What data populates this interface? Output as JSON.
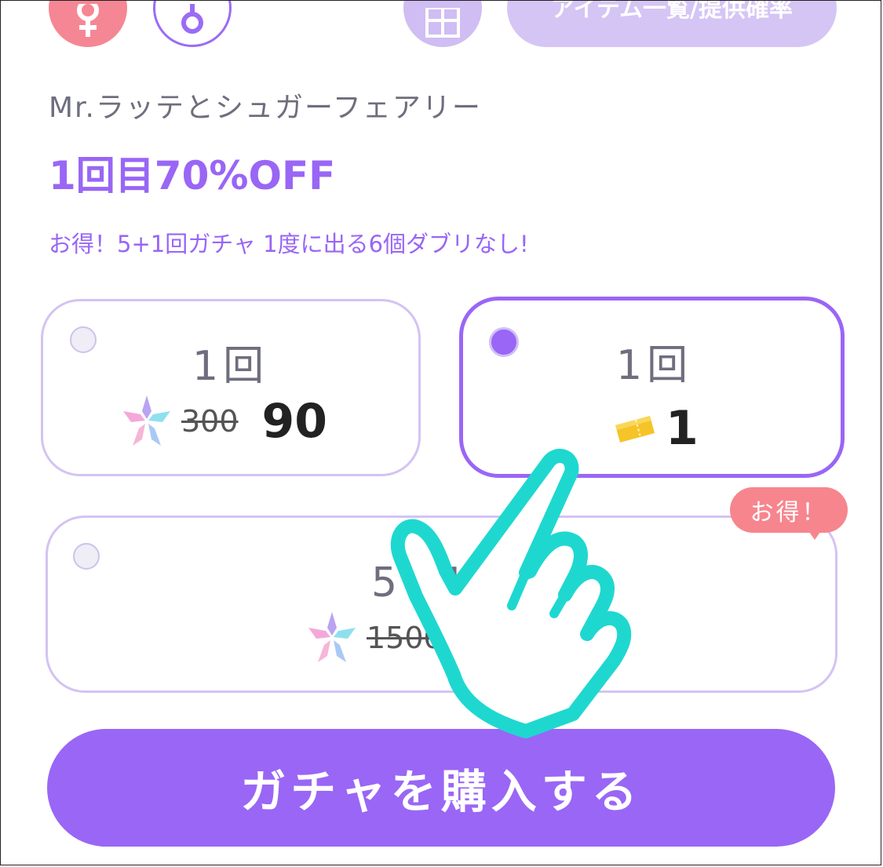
{
  "header": {
    "item_list_label": "アイテム一覧/提供確率"
  },
  "gacha": {
    "title": "Mr.ラッテとシュガーフェアリー",
    "discount": "1回目70%OFF",
    "subtitle": "お得！5+1回ガチャ 1度に出る6個ダブリなし!"
  },
  "options": [
    {
      "count": "1回",
      "old_price": "300",
      "price": "90",
      "currency_icon": "star-crystal-icon",
      "selected": false
    },
    {
      "count": "1回",
      "ticket_count": "1",
      "currency_icon": "ticket-icon",
      "selected": true
    },
    {
      "count": "5+1回",
      "old_price": "1500",
      "currency_icon": "star-crystal-icon",
      "selected": false
    }
  ],
  "badge": "お得！",
  "buy_button": "ガチャを購入する",
  "colors": {
    "accent": "#9a66f5",
    "pink": "#f7858e",
    "border_light": "#d4c3f2",
    "hand": "#1ed8d0"
  }
}
